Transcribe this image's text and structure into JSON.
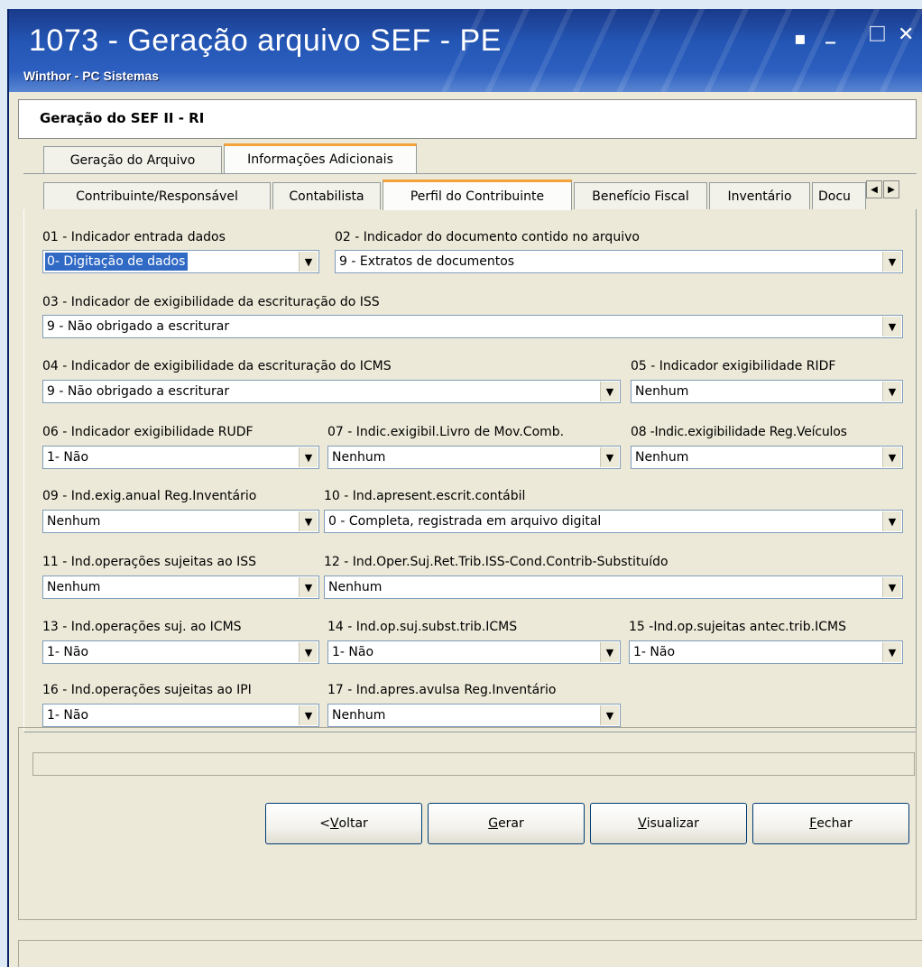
{
  "window": {
    "title": "1073 - Geração arquivo SEF - PE",
    "subtitle": "Winthor - PC Sistemas",
    "controls": {
      "restore": "▪",
      "minimize": "_",
      "maximize": "□",
      "close": "✕"
    }
  },
  "header": {
    "title": "Geração do SEF II - RI"
  },
  "tabs_top": [
    {
      "label": "Geração do Arquivo"
    },
    {
      "label": "Informações Adicionais"
    }
  ],
  "tabs_sub": [
    {
      "label": "Contribuinte/Responsável"
    },
    {
      "label": "Contabilista"
    },
    {
      "label": "Perfil do Contribuinte"
    },
    {
      "label": "Benefício Fiscal"
    },
    {
      "label": "Inventário"
    },
    {
      "label": "Docu"
    }
  ],
  "tab_scroll": {
    "left": "◀",
    "right": "▶"
  },
  "fields": {
    "f01": {
      "label": "01 - Indicador entrada dados",
      "value": "0- Digitação de dados"
    },
    "f02": {
      "label": "02 - Indicador do documento contido no arquivo",
      "value": "9 - Extratos de documentos"
    },
    "f03": {
      "label": "03 - Indicador de exigibilidade da escrituração do ISS",
      "value": "9 - Não obrigado a escriturar"
    },
    "f04": {
      "label": "04 - Indicador de exigibilidade da escrituração do ICMS",
      "value": "9 - Não obrigado a escriturar"
    },
    "f05": {
      "label": "05 - Indicador exigibilidade RIDF",
      "value": "Nenhum"
    },
    "f06": {
      "label": "06 - Indicador exigibilidade RUDF",
      "value": "1- Não"
    },
    "f07": {
      "label": "07 - Indic.exigibil.Livro de Mov.Comb.",
      "value": "Nenhum"
    },
    "f08": {
      "label": "08 -Indic.exigibilidade Reg.Veículos",
      "value": "Nenhum"
    },
    "f09": {
      "label": "09 - Ind.exig.anual Reg.Inventário",
      "value": "Nenhum"
    },
    "f10": {
      "label": "10 - Ind.apresent.escrit.contábil",
      "value": "0 - Completa, registrada em arquivo digital"
    },
    "f11": {
      "label": "11 - Ind.operações sujeitas ao ISS",
      "value": "Nenhum"
    },
    "f12": {
      "label": "12 - Ind.Oper.Suj.Ret.Trib.ISS-Cond.Contrib-Substituído",
      "value": "Nenhum"
    },
    "f13": {
      "label": "13 - Ind.operações suj. ao ICMS",
      "value": "1- Não"
    },
    "f14": {
      "label": "14 - Ind.op.suj.subst.trib.ICMS",
      "value": "1- Não"
    },
    "f15": {
      "label": "15 -Ind.op.sujeitas antec.trib.ICMS",
      "value": "1- Não"
    },
    "f16": {
      "label": "16 - Ind.operações sujeitas ao IPI",
      "value": "1- Não"
    },
    "f17": {
      "label": "17 - Ind.apres.avulsa Reg.Inventário",
      "value": "Nenhum"
    }
  },
  "dropdown_arrow": "▼",
  "buttons": {
    "voltar": {
      "prefix": "< ",
      "u": "V",
      "rest": "oltar"
    },
    "gerar": {
      "u": "G",
      "rest": "erar"
    },
    "visualizar": {
      "u": "V",
      "rest": "isualizar"
    },
    "fechar": {
      "u": "F",
      "rest": "echar"
    }
  },
  "colors": {
    "title_bar": "#2456b5",
    "active_tab": "#f4a23a",
    "selection": "#316ac5"
  }
}
